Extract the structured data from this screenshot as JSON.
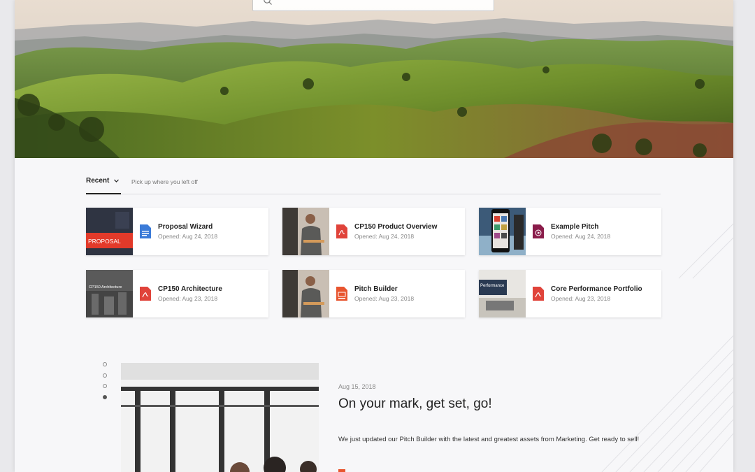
{
  "search": {
    "placeholder": ""
  },
  "recent": {
    "tab_label": "Recent",
    "subtitle": "Pick up where you left off",
    "items": [
      {
        "title": "Proposal Wizard",
        "date": "Opened: Aug 24, 2018",
        "file_type": "doc",
        "thumb_text": "PROPOSAL"
      },
      {
        "title": "CP150 Product Overview",
        "date": "Opened: Aug 24, 2018",
        "file_type": "pdf",
        "thumb_text": ""
      },
      {
        "title": "Example Pitch",
        "date": "Opened: Aug 24, 2018",
        "file_type": "video",
        "thumb_text": ""
      },
      {
        "title": "CP150 Architecture",
        "date": "Opened: Aug 23, 2018",
        "file_type": "pdf",
        "thumb_text": "CP150 Architecture"
      },
      {
        "title": "Pitch Builder",
        "date": "Opened: Aug 23, 2018",
        "file_type": "ppt",
        "thumb_text": ""
      },
      {
        "title": "Core Performance Portfolio",
        "date": "Opened: Aug 23, 2018",
        "file_type": "pdf",
        "thumb_text": "Performance"
      }
    ]
  },
  "news": {
    "date": "Aug 15, 2018",
    "title": "On your mark, get set, go!",
    "body": "We just updated our Pitch Builder with the latest and greatest assets from Marketing. Get ready to sell!",
    "slide_count": 4,
    "active_slide": 3
  },
  "colors": {
    "pdf": "#e0433a",
    "doc": "#3b7bd8",
    "ppt": "#e8552f",
    "video": "#8a1c4a",
    "accent": "#222222"
  }
}
